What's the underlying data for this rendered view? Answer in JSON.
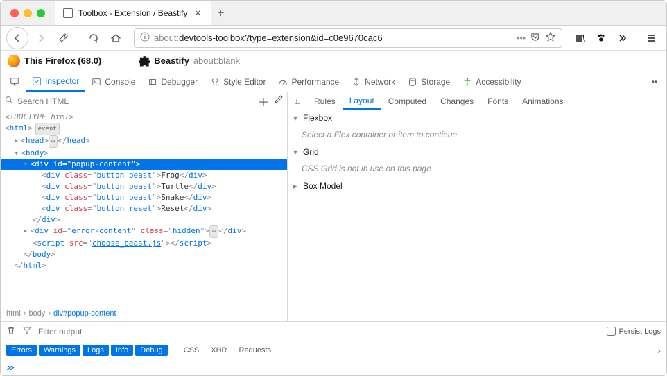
{
  "window": {
    "tab_title": "Toolbox - Extension / Beastify"
  },
  "url": {
    "scheme": "about:",
    "path": "devtools-toolbox?type=extension&id=c0e9670cac6"
  },
  "ext_header": {
    "firefox_label": "This Firefox (68.0)",
    "ext_name": "Beastify",
    "ext_url": "about:blank"
  },
  "devtools_tabs": {
    "inspector": "Inspector",
    "console": "Console",
    "debugger": "Debugger",
    "style_editor": "Style Editor",
    "performance": "Performance",
    "network": "Network",
    "storage": "Storage",
    "accessibility": "Accessibility"
  },
  "search": {
    "placeholder": "Search HTML"
  },
  "dom": {
    "doctype": "<!DOCTYPE html>",
    "html_open": "html",
    "event_badge": "event",
    "head": "head",
    "body": "body",
    "popup_id": "popup-content",
    "beast_class": "button beast",
    "reset_class": "button reset",
    "div_tag": "div",
    "b1": "Frog",
    "b2": "Turtle",
    "b3": "Snake",
    "b4": "Reset",
    "err_id": "error-content",
    "err_class": "hidden",
    "script_src": "choose_beast.js",
    "script_tag": "script",
    "html_close": "html",
    "body_close": "body"
  },
  "breadcrumbs": {
    "c1": "html",
    "c2": "body",
    "c3": "div#popup-content"
  },
  "right_tabs": {
    "rules": "Rules",
    "layout": "Layout",
    "computed": "Computed",
    "changes": "Changes",
    "fonts": "Fonts",
    "animations": "Animations"
  },
  "layout_panel": {
    "flexbox_head": "Flexbox",
    "flexbox_body": "Select a Flex container or item to continue.",
    "grid_head": "Grid",
    "grid_body": "CSS Grid is not in use on this page",
    "boxmodel_head": "Box Model"
  },
  "filter": {
    "placeholder": "Filter output",
    "persist": "Persist Logs"
  },
  "pills": {
    "errors": "Errors",
    "warnings": "Warnings",
    "logs": "Logs",
    "info": "Info",
    "debug": "Debug",
    "css": "CSS",
    "xhr": "XHR",
    "requests": "Requests"
  }
}
